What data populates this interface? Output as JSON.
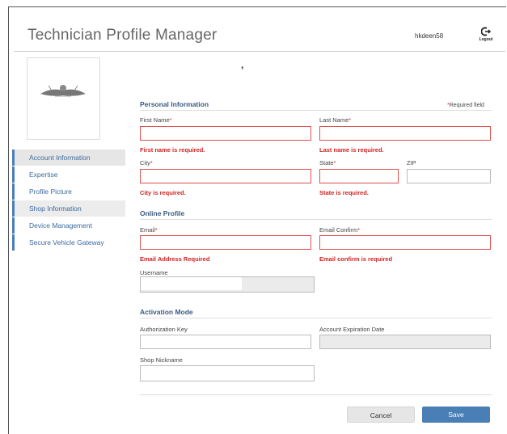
{
  "header": {
    "title": "Technician Profile Manager",
    "username": "hkdeen58",
    "logout_label": "Logout"
  },
  "loading_glyph": "’",
  "sidebar": {
    "items": [
      {
        "label": "Account Information"
      },
      {
        "label": "Expertise"
      },
      {
        "label": "Profile Picture"
      },
      {
        "label": "Shop Information"
      },
      {
        "label": "Device Management"
      },
      {
        "label": "Secure Vehicle Gateway"
      }
    ]
  },
  "personal": {
    "title": "Personal Information",
    "required_note": "Required field",
    "first_name": {
      "label": "First Name",
      "value": "",
      "error": "First name is required."
    },
    "last_name": {
      "label": "Last Name",
      "value": "",
      "error": "Last name is required."
    },
    "city": {
      "label": "City",
      "value": "",
      "error": "City is required."
    },
    "state": {
      "label": "State",
      "value": "",
      "error": "State is required."
    },
    "zip": {
      "label": "ZIP",
      "value": ""
    }
  },
  "online": {
    "title": "Online Profile",
    "email": {
      "label": "Email",
      "value": "",
      "error": "Email Address Required"
    },
    "email_confirm": {
      "label": "Email Confirm",
      "value": "",
      "error": "Email confirm is required"
    },
    "username": {
      "label": "Username",
      "value": ""
    }
  },
  "activation": {
    "title": "Activation Mode",
    "auth_key": {
      "label": "Authorization Key",
      "value": ""
    },
    "expiration": {
      "label": "Account Expiration Date",
      "value": ""
    },
    "shop_nickname": {
      "label": "Shop Nickname",
      "value": ""
    }
  },
  "actions": {
    "cancel_label": "Cancel",
    "save_label": "Save"
  },
  "colors": {
    "accent": "#4a7fb5",
    "error": "#d42020",
    "section_title": "#3a5a80"
  }
}
